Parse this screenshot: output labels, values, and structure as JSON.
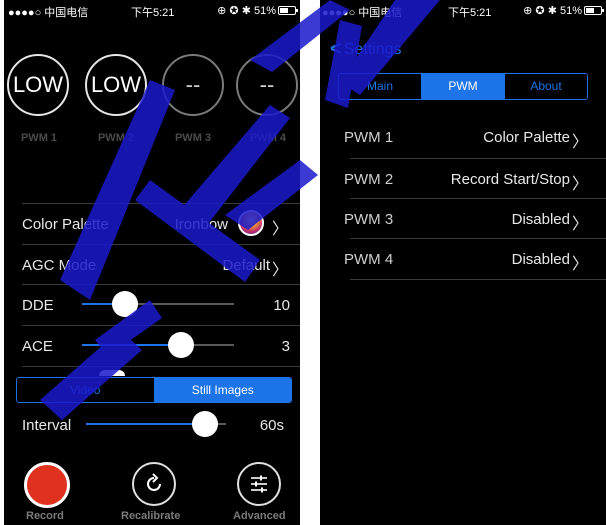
{
  "status_bar": {
    "carrier": "●●●●○ 中国电信 ",
    "time": "下午5:21",
    "indicators": "⊕ ✪ ✱ 51%",
    "battery_percent": 51
  },
  "left_screen": {
    "pwm_channels": [
      {
        "value": "LOW",
        "label": "PWM 1"
      },
      {
        "value": "LOW",
        "label": "PWM 2"
      },
      {
        "value": "--",
        "label": "PWM 3"
      },
      {
        "value": "--",
        "label": "PWM 4"
      }
    ],
    "color_palette": {
      "label": "Color Palette",
      "value": "Ironbow"
    },
    "agc_mode": {
      "label": "AGC Mode",
      "value": "Default"
    },
    "dde": {
      "label": "DDE",
      "value": "10",
      "level": 0.28
    },
    "ace": {
      "label": "ACE",
      "value": "3",
      "level": 0.65
    },
    "mode_tabs": [
      {
        "label": "Video",
        "selected": false
      },
      {
        "label": "Still Images",
        "selected": true
      }
    ],
    "interval": {
      "label": "Interval",
      "value": "60s",
      "level": 0.85
    },
    "bottom_buttons": [
      {
        "label": "Record",
        "icon": "record-icon"
      },
      {
        "label": "Recalibrate",
        "icon": "refresh-icon"
      },
      {
        "label": "Advanced",
        "icon": "sliders-icon"
      }
    ]
  },
  "right_screen": {
    "back_label": "Settings",
    "tabs": [
      {
        "label": "Main",
        "selected": false
      },
      {
        "label": "PWM",
        "selected": true
      },
      {
        "label": "About",
        "selected": false
      }
    ],
    "pwm_settings": [
      {
        "label": "PWM 1",
        "value": "Color Palette"
      },
      {
        "label": "PWM 2",
        "value": "Record Start/Stop"
      },
      {
        "label": "PWM 3",
        "value": "Disabled"
      },
      {
        "label": "PWM 4",
        "value": "Disabled"
      }
    ]
  },
  "colors": {
    "accent": "#1d73e8",
    "record": "#e0301e",
    "background": "#000000",
    "watermark": "#1a1acc"
  }
}
